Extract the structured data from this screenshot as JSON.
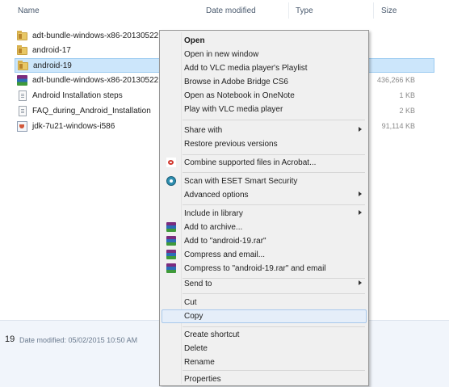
{
  "columns": {
    "name": "Name",
    "date_modified": "Date modified",
    "type": "Type",
    "size": "Size"
  },
  "files": [
    {
      "name": "adt-bundle-windows-x86-20130522",
      "size": "",
      "icon": "folder-icon"
    },
    {
      "name": "android-17",
      "size": "",
      "icon": "folder-icon"
    },
    {
      "name": "android-19",
      "size": "",
      "icon": "folder-icon",
      "selected": true
    },
    {
      "name": "adt-bundle-windows-x86-20130522",
      "size": "436,266 KB",
      "icon": "winrar-archive-icon"
    },
    {
      "name": "Android Installation steps",
      "size": "1 KB",
      "icon": "text-document-icon"
    },
    {
      "name": "FAQ_during_Android_Installation",
      "size": "2 KB",
      "icon": "text-document-icon"
    },
    {
      "name": "jdk-7u21-windows-i586",
      "size": "91,114 KB",
      "icon": "java-installer-icon"
    }
  ],
  "status": {
    "count": "19",
    "text": "Date modified: 05/02/2015 10:50 AM"
  },
  "context_menu": {
    "open": "Open",
    "open_new_window": "Open in new window",
    "add_vlc_playlist": "Add to VLC media player's Playlist",
    "browse_bridge": "Browse in Adobe Bridge CS6",
    "open_onenote": "Open as Notebook in OneNote",
    "play_vlc": "Play with VLC media player",
    "share_with": "Share with",
    "restore_versions": "Restore previous versions",
    "combine_acrobat": "Combine supported files in Acrobat...",
    "scan_eset": "Scan with ESET Smart Security",
    "advanced_options": "Advanced options",
    "include_library": "Include in library",
    "add_archive": "Add to archive...",
    "add_rar": "Add to \"android-19.rar\"",
    "compress_email": "Compress and email...",
    "compress_rar_email": "Compress to \"android-19.rar\" and email",
    "send_to": "Send to",
    "cut": "Cut",
    "copy": "Copy",
    "create_shortcut": "Create shortcut",
    "delete": "Delete",
    "rename": "Rename",
    "properties": "Properties"
  },
  "colors": {
    "selection": "#cce6fb",
    "menu_bg": "#f0f0f0",
    "hover": "#e5eef9"
  }
}
